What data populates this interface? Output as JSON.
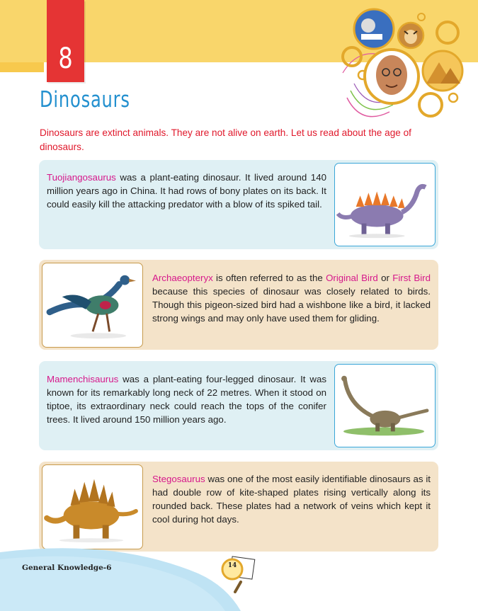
{
  "chapter": {
    "number": "8",
    "title": "Dinosaurs"
  },
  "intro": "Dinosaurs are extinct animals. They are not alive on earth. Let us read about the age of dinosaurs.",
  "cards": [
    {
      "name": "Tuojiangosaurus",
      "text": " was a plant-eating dinosaur. It lived around 140 million years ago in China. It had rows of bony plates on its back. It could easily kill the attacking predator with a blow of its spiked tail."
    },
    {
      "name": "Archaeopteryx",
      "text_a": " is often referred to as the ",
      "highlight_1": "Original Bird",
      "text_b": " or ",
      "highlight_2": "First Bird",
      "text_c": " because this species of dinosaur was closely related to birds. Though this pigeon-sized bird had a wishbone like a bird, it lacked strong wings and may only have used them for gliding."
    },
    {
      "name": "Mamenchisaurus",
      "text": " was a plant-eating four-legged dinosaur. It was known for its remarkably long neck of 22 metres. When it stood on tiptoe, its extraordinary neck could reach the tops of the conifer trees. It lived around 150 million years ago."
    },
    {
      "name": "Stegosaurus",
      "text": " was one of the most easily identifiable dinosaurs as it had double row of kite-shaped plates rising vertically along its rounded back. These plates had a network of veins which kept it cool during hot days."
    }
  ],
  "footer": {
    "book": "General Knowledge-6",
    "page": "14"
  },
  "colors": {
    "accent_red": "#e53434",
    "title_blue": "#2390cf",
    "name_magenta": "#d6188b",
    "band_yellow": "#f9d66b"
  }
}
